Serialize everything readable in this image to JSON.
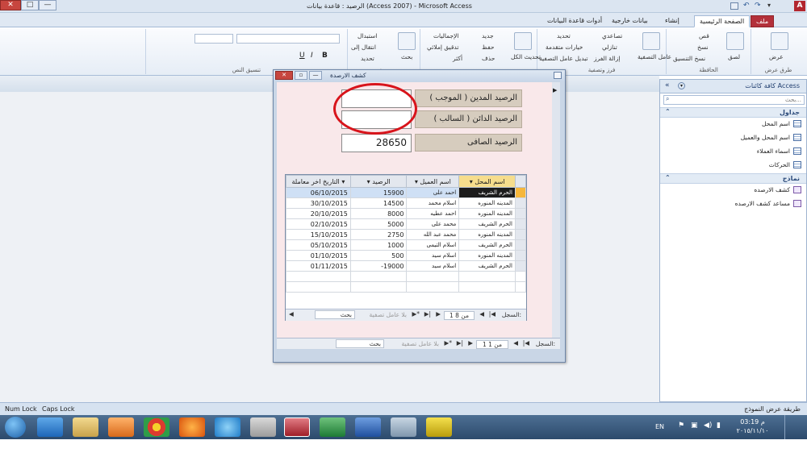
{
  "window": {
    "title": "الرصيد : قاعدة بيانات (Access 2007) - Microsoft Access",
    "logo_letter": "A",
    "close_glyph": "✕",
    "max_glyph": "□",
    "min_glyph": "—"
  },
  "tabs": [
    "ملف",
    "الصفحة الرئيسية",
    "إنشاء",
    "بيانات خارجية",
    "أدوات قاعدة البيانات"
  ],
  "ribbon": {
    "views": {
      "label": "طرق عرض",
      "item": "عرض"
    },
    "clipboard": {
      "label": "الحافظة",
      "paste": "لصق",
      "cut": "قص",
      "copy": "نسخ",
      "format_painter": "نسخ التنسيق"
    },
    "sort_filter": {
      "label": "فرز وتصفية",
      "filter": "عامل التصفية",
      "asc": "تصاعدي",
      "desc": "تنازلي",
      "remove_sort": "إزالة الفرز",
      "selection": "تحديد",
      "advanced": "خيارات متقدمة",
      "toggle": "تبديل عامل التصفية"
    },
    "records": {
      "label": "",
      "refresh": "تحديث الكل",
      "new": "جديد",
      "save": "حفظ",
      "delete": "حذف",
      "totals": "الإجماليات",
      "spelling": "تدقيق إملائي",
      "more": "أكثر"
    },
    "find": {
      "label": "بحث",
      "find": "بحث",
      "replace": "استبدال",
      "goto": "انتقال إلى",
      "select": "تحديد"
    },
    "text_format": {
      "label": "تنسيق النص"
    }
  },
  "nav": {
    "title": "كافة كائنات Access",
    "search_placeholder": "بحث...",
    "sections": [
      {
        "name": "جداول",
        "items": [
          "اسم المحل",
          "اسم المحل والعميل",
          "اسماء العملاء",
          "الحركات"
        ]
      },
      {
        "name": "نماذج",
        "items": [
          "كشف الارصده",
          "مساعد كشف الارصده"
        ]
      }
    ]
  },
  "form": {
    "title": "كشف الارصدة",
    "debit_label": "الرصيد المدين ( الموجب )",
    "credit_label": "الرصيد الدائن ( السالب )",
    "net_label": "الرصيد الصافى",
    "debit_value": "",
    "credit_value": "",
    "net_value": "28650",
    "record_nav": {
      "label": "السجل:",
      "position": "1 من 1",
      "filter": "بلا عامل تصفية",
      "search": "بحث"
    }
  },
  "subform": {
    "columns": [
      "اسم المحل",
      "اسم العميل",
      "الرصيد",
      "التاريخ اخر معاملة"
    ],
    "rows": [
      [
        "الحرم الشريف",
        "احمد على",
        "15900",
        "06/10/2015"
      ],
      [
        "المدينه المنوره",
        "اسلام محمد",
        "14500",
        "30/10/2015"
      ],
      [
        "المدينه المنوره",
        "احمد عطيه",
        "8000",
        "20/10/2015"
      ],
      [
        "الحرم الشريف",
        "محمد على",
        "5000",
        "02/10/2015"
      ],
      [
        "المدينه المنوره",
        "محمد عبد الله",
        "2750",
        "15/10/2015"
      ],
      [
        "الحرم الشريف",
        "اسلام التيمى",
        "1000",
        "05/10/2015"
      ],
      [
        "المدينه المنوره",
        "اسلام سيد",
        "500",
        "01/10/2015"
      ],
      [
        "الحرم الشريف",
        "اسلام سيد",
        "-19000",
        "01/11/2015"
      ]
    ],
    "record_nav": {
      "label": "السجل:",
      "position": "1 من 8",
      "filter": "بلا عامل تصفية",
      "search": "بحث"
    }
  },
  "status": {
    "left1": "Num Lock",
    "left2": "Caps Lock",
    "right": "طريقة عرض النموذج"
  },
  "taskbar": {
    "lang": "EN",
    "time": "03:19 م",
    "date": "٢٠١٥/١١/١٠"
  },
  "colors": {
    "highlight_circle": "#d8141b",
    "file_tab": "#b3303a",
    "selected_row": "#cfe0f5"
  }
}
